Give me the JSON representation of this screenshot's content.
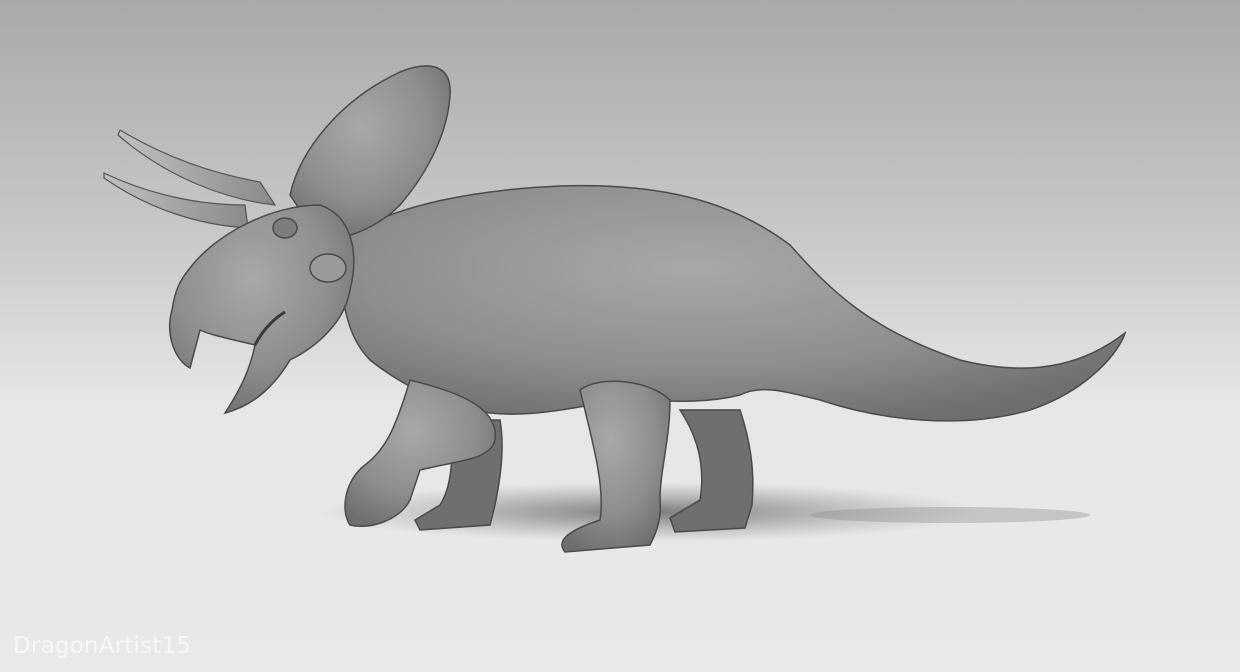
{
  "image": {
    "subject": "triceratops-sculpture",
    "watermark": "DragonArtist15",
    "colors": {
      "skin": "#8c8c8c",
      "skin_light": "#b0b0b0",
      "shadow": "#5a5a5a",
      "background_top": "#a9a9a9",
      "background_bottom": "#e9e9e9"
    }
  }
}
